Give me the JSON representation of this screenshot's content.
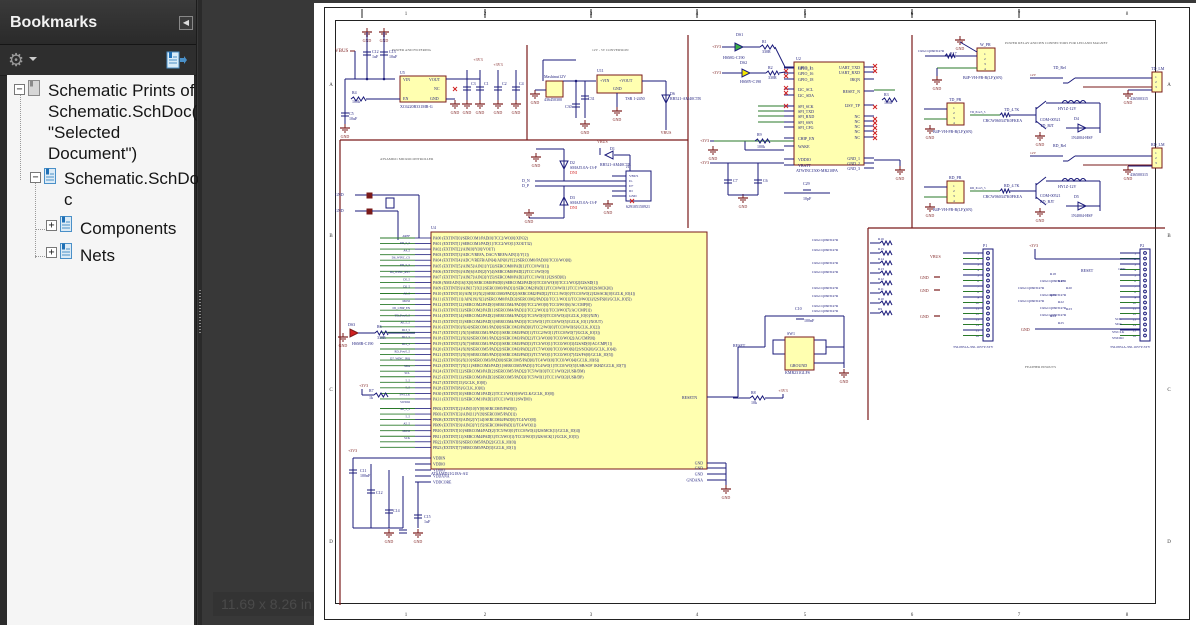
{
  "bookmarks_panel": {
    "title": "Bookmarks",
    "collapse_icon": "triangle-left-icon",
    "options_icon": "gear-icon",
    "action_icon": "bookmark-export-icon",
    "tree": [
      {
        "label_lines": [
          "Schematic Prints of",
          "Schematic.SchDoc(",
          "\"Selected",
          "Document\")"
        ],
        "state": "expanded"
      },
      {
        "label_lines": [
          "Schematic.SchDo",
          "c"
        ],
        "state": "expanded"
      },
      {
        "label_lines": [
          "Components"
        ],
        "state": "collapsed"
      },
      {
        "label_lines": [
          "Nets"
        ],
        "state": "collapsed"
      }
    ]
  },
  "page_size_label": "11.69 x 8.26 in",
  "schematic": {
    "zone_columns": [
      "1",
      "2",
      "3",
      "4",
      "5",
      "6",
      "7",
      "8"
    ],
    "zone_rows": [
      "A",
      "B",
      "C",
      "D"
    ],
    "section_titles": {
      "power": "POWER AND FILTERING",
      "conv": "12V - 5V CONVERSION",
      "mcu": "ATSAMD21 MICROCONTROLLER",
      "relay": "POWER RELAY AND PIN CONNECTORS FOR LED AND MAGNET",
      "headers": "FEATHER PINOUTS"
    },
    "labels": {
      "vbus": "VBUS",
      "gnd": "GND",
      "v3": "+3V3",
      "u5": "U5",
      "u5_part": "XC6220B331MR-G",
      "u5_vin": "VIN",
      "u5_vout": "VOUT",
      "u5_nc": "NC",
      "u5_en": "EN",
      "u5_gnd": "GND",
      "r4": "R4",
      "r4v": "100k",
      "c5": "C5",
      "c5v": "10uF",
      "c12": "C12",
      "c12v": "1uF",
      "c13": "C13",
      "c13v": "10uF",
      "c3": "C3",
      "c3v": "10uF",
      "c1": "C1",
      "c1v": "1uF",
      "c4": "C4",
      "c4v": "1uF",
      "c2": "C2",
      "c2v": "10uF",
      "jack": "Mashinut12V",
      "jack_part": "436450300",
      "j_12v": "12V",
      "u11": "U11",
      "u11_vin": "+VIN",
      "u11_vout": "+VOUT",
      "u11_gnd": "GND",
      "u11_part": "TSR 1-2450",
      "c30": "C30",
      "c30v": "1uF",
      "c31": "C31",
      "c31v": "10uF",
      "d6": "D6",
      "d6_part": "RB521-AM40CTR",
      "ds1": "DS1",
      "ds1_part": "HSMG-C190",
      "ds2": "DS2",
      "ds2_part": "HSMY-C190",
      "r1": "R1",
      "r1v": "330R",
      "r2": "R2",
      "r2v": "330R",
      "u2": "U2",
      "u2_part": "ATWINC1500-MR210PA",
      "u2_left": [
        "GPIO_1",
        "GPIO_15",
        "GPIO_16",
        "GPIO_18",
        "I2C_SCL",
        "I2C_SDA",
        "SPI_SCK",
        "SPI_TXD",
        "SPI_RXD",
        "SPI_SSN",
        "SPI_CFG",
        "CHIP_EN",
        "WAKE",
        "VDDIO",
        "VBATT"
      ],
      "u2_right": [
        "UART_TXD",
        "UART_RXD",
        "IRQN",
        "RESET_N",
        "I2SV_TP",
        "NC",
        "NC",
        "NC",
        "NC",
        "NC",
        "GND_1",
        "GND_2",
        "GND_3"
      ],
      "r3": "R3",
      "r3v": "100k",
      "r9": "R9",
      "r9v": "100k",
      "c7": "C7",
      "c7v": "100nF",
      "c6": "C6",
      "c6v": "10pF",
      "c29": "C29",
      "c29v": "10pF",
      "d2": "D2",
      "d2_part": "SMAJ5.0A-13-F",
      "d3": "D3",
      "d3_part": "SMAJ5.0A-13-F",
      "d1": "D1",
      "d1_part": "RB521-AM40CTR",
      "dni": "DNI",
      "j1": "J1",
      "j1_pins": [
        "VBUS",
        "D-",
        "D+",
        "ID",
        "GND"
      ],
      "j1_part": "629105150921",
      "dn": "D_N",
      "dp": "D_P",
      "u4": "U4",
      "u4_part": "ATSAMD21G18A-AU",
      "u4_pins": [
        "PA00 (EXTINT[0]/SERCOM1/PAD[0]/TCC2/WO[0]/XIN32)",
        "PA01 (EXTINT[1]/SERCOM1/PAD[1]/TCC2/WO[1]/XOUT32)",
        "PA02 (EXTINT[2]/AIN[0]/Y[0]/VOUT)",
        "PA03 (EXTINT[3]/ADC/VREFA, DAC/VREFA/AIN[1]/Y[1])",
        "PA04 (EXTINT[4]/ADC/VREFB/AIN[4]/AIN[0]/Y[2]/SERCOM0/PAD[0]/TCC0/WO[0])",
        "PA05 (EXTINT[5]/AIN[5]/AIN[1]/Y[3]/SERCOM0/PAD[1]/TCC0/WO[1])",
        "PA06 (EXTINT[6]/AIN[6]/AIN[2]/Y[4]/SERCOM0/PAD[2]/TCC1/WO[0])",
        "PA07 (EXTINT[7]/AIN[7]/AIN[3]/Y[5]/SERCOM0/PAD[3]/TCC1/WO[1]/I2S/SD[0])",
        "PA08 (NMI/AIN[16]/X[0]/SERCOM0/PAD[0]/SERCOM2/PAD[0]/TCC0/WO[0]/TCC1/WO[2]/I2S/SD[1])",
        "PA09 (EXTINT[9]/AIN[17]/X[1]/SERCOM0/PAD[1]/SERCOM2/PAD[1]/TCC0/WO[1]/TCC1/WO[3]/I2S/MCK[0])",
        "PA10 (EXTINT[10]/AIN[18]/X[2]/SERCOM0/PAD[2]/SERCOM2/PAD[2]/TCC1/WO[0]/TCC0/WO[2]/I2S/SCK[0]/GCLK_IO[4])",
        "PA11 (EXTINT[11]/AIN[19]/X[3]/SERCOM0/PAD[3]/SERCOM2/PAD[3]/TCC1/WO[1]/TCC0/WO[3]/I2S/FS[0]/GCLK_IO[5])",
        "PA12 (EXTINT[12]/SERCOM2/PAD[0]/SERCOM4/PAD[0]/TCC2/WO[0]/TCC0/WO[6]/AC/CMP[0])",
        "PA13 (EXTINT[13]/SERCOM2/PAD[1]/SERCOM4/PAD[1]/TCC2/WO[1]/TCC0/WO[7]/AC/CMP[1])",
        "PA14 (EXTINT[14]/SERCOM2/PAD[2]/SERCOM4/PAD[2]/TC3/WO[0]/TCC0/WO[4]/GCLK_IO[0]/XIN)",
        "PA15 (EXTINT[15]/SERCOM2/PAD[3]/SERCOM4/PAD[3]/TC3/WO[1]/TCC0/WO[5]/GCLK_IO[1]/XOUT)",
        "PA16 (EXTINT[0]/X[4]/SERCOM1/PAD[0]/SERCOM3/PAD[0]/TCC2/WO[0]/TCC0/WO[6]/GCLK_IO[2])",
        "PA17 (EXTINT[1]/X[5]/SERCOM1/PAD[1]/SERCOM3/PAD[1]/TCC2/WO[1]/TCC0/WO[7]/GCLK_IO[3])",
        "PA18 (EXTINT[2]/X[6]/SERCOM1/PAD[2]/SERCOM3/PAD[2]/TC3/WO[0]/TCC0/WO[2]/AC/CMP[0])",
        "PA19 (EXTINT[3]/X[7]/SERCOM1/PAD[3]/SERCOM3/PAD[3]/TC3/WO[1]/TCC0/WO[3]/I2S/SD[0]/AC/CMP[1])",
        "PA20 (EXTINT[4]/X[8]/SERCOM5/PAD[2]/SERCOM3/PAD[2]/TC7/WO[0]/TCC0/WO[6]/I2S/SCK[0]/GCLK_IO[4])",
        "PA21 (EXTINT[5]/X[9]/SERCOM5/PAD[3]/SERCOM3/PAD[3]/TC7/WO[1]/TCC0/WO[7]/I2S/FS[0]/GCLK_IO[5])",
        "PA22 (EXTINT[6]/X[10]/SERCOM3/PAD[0]/SERCOM5/PAD[0]/TC4/WO[0]/TCC0/WO[4]/GCLK_IO[6])",
        "PA23 (EXTINT[7]/X[11]/SERCOM3/PAD[1]/SERCOM5/PAD[1]/TC4/WO[1]/TCC0/WO[5]/USB/SOF 1KHZ/GCLK_IO[7])",
        "PA24 (EXTINT[12]/SERCOM3/PAD[2]/SERCOM5/PAD[2]/TC5/WO[0]/TCC1/WO[2]/USB/DM)",
        "PA25 (EXTINT[13]/SERCOM3/PAD[3]/SERCOM5/PAD[3]/TC5/WO[1]/TCC1/WO[3]/USB/DP)",
        "PA27 (EXTINT[15]/GCLK_IO[0])",
        "PA28 (EXTINT[8]/GCLK_IO[0])",
        "PA30 (EXTINT[10]/SERCOM1/PAD[2]/TCC1/WO[0]/SWCLK/GCLK_IO[0])",
        "PA31 (EXTINT[11]/SERCOM1/PAD[3]/TCC1/WO[1]/SWDIO)",
        "PB02 (EXTINT[2]/AIN[10]/Y[8]/SERCOM5/PAD[0])",
        "PB03 (EXTINT[3]/AIN[11]/Y[9]/SERCOM5/PAD[1])",
        "PB08 (EXTINT[8]/AIN[2]/Y[14]/SERCOM4/PAD[0]/TC4/WO[0])",
        "PB09 (EXTINT[9]/AIN[3]/Y[15]/SERCOM4/PAD[1]/TC4/WO[1])",
        "PB10 (EXTINT[10]/SERCOM4/PAD[2]/TC5/WO[0]/TCC0/WO[4]/I2S/MCK[1]/GCLK_IO[4])",
        "PB11 (EXTINT[11]/SERCOM4/PAD[3]/TC5/WO[1]/TCC0/WO[5]/I2S/SCK[1]/GCLK_IO[5])",
        "PB22 (EXTINT[6]/SERCOM5/PAD[2]/GCLK_IO[0])",
        "PB23 (EXTINT[7]/SERCOM5/PAD[3]/GCLK_IO[1])"
      ],
      "u4_power_left": [
        "VDDIN",
        "VDDIO",
        "VDDIO",
        "VDDANA",
        "VDDCORE"
      ],
      "u4_power_right": [
        "GND",
        "GND",
        "GND",
        "GNDANA"
      ],
      "resetn": "RESETN",
      "reset": "RESET",
      "sw1": "SW1",
      "sw1_part": "KMR231GLFS",
      "sw1_ground": "GROUND",
      "c10": "C10",
      "c10v": "100nF",
      "r8": "R8",
      "r8v": "10k",
      "ds3": "DS3",
      "ds3_part": "HSMR-C190",
      "r6": "R6",
      "r6v": "330R",
      "r7": "R7",
      "r7v": "1k",
      "c11": "C11",
      "c11v": "100nF",
      "c12b": "C12",
      "c14": "C14",
      "c15": "C15",
      "c15v": "1uF",
      "v100n": "100nF",
      "net_labels": [
        "AREF",
        "PD_5_5",
        "A4_5",
        "D6_WINC_CS",
        "PD_5_5",
        "D4_WINC_RST",
        "D5_5",
        "D2_5",
        "A0_5",
        "MOSI",
        "D5_CHIP_EN",
        "TD_Pow5_5",
        "A0_5_5",
        "D13_5",
        "D12_5",
        "D12_5",
        "RD_Pow5_5",
        "D7_WINC_IRQ",
        "SDA",
        "SCL",
        "5_5",
        "5_5",
        "SWCLK",
        "SWDIO",
        "A0_5_5",
        "5_5",
        "A5_5",
        "MOSI",
        "SCK"
      ],
      "w_pr": "W_PR",
      "w_pr_part": "B4P-VH-FB-B(LF)(SN)",
      "td_pr": "TD_PR",
      "rd_pr": "RD_PR",
      "td_rel": "TD_Rel",
      "rd_rel": "RD_Rel",
      "relay_part": "HY1Z-12V",
      "td_bjt": "TD_BJT",
      "rd_bjt": "RD_BJT",
      "bjt_part": "COM-00521",
      "bjt_res_part": "CRCW060347K0FKEA",
      "td_r": "TD_4.7K",
      "rd_r": "RD_4.7K",
      "d4": "D4",
      "d5": "D5",
      "diode_part": "1N4004-HSF",
      "td_lm": "TD_LM",
      "rd_lm": "RD_LM",
      "lm_part": "436500315",
      "v12": "12V",
      "r17": "R17",
      "r17_part": "CRGCQ0603J47R",
      "p1": "P1",
      "p2": "P2",
      "hdr_part": "TSL0831A-350-1657Y-STY",
      "res_part": "CRGCQ0603J47R",
      "p1_nets": [
        "VBUS",
        "D1",
        "D13",
        "D12",
        "A2",
        "A4",
        "D12",
        "D3",
        "D2",
        "A0S",
        "AIDT",
        "MISO"
      ],
      "p2_nets": [
        "AREF",
        "RESET",
        "SCL",
        "SDA",
        "SWCLK",
        "SWDIO"
      ],
      "r_hdr": [
        "R16",
        "R15",
        "R14",
        "R13",
        "R12",
        "R11",
        "R10",
        "R9",
        "R18",
        "R19",
        "R20",
        "R21",
        "R22",
        "R23",
        "R24",
        "R25"
      ],
      "r25v": "100R"
    }
  }
}
